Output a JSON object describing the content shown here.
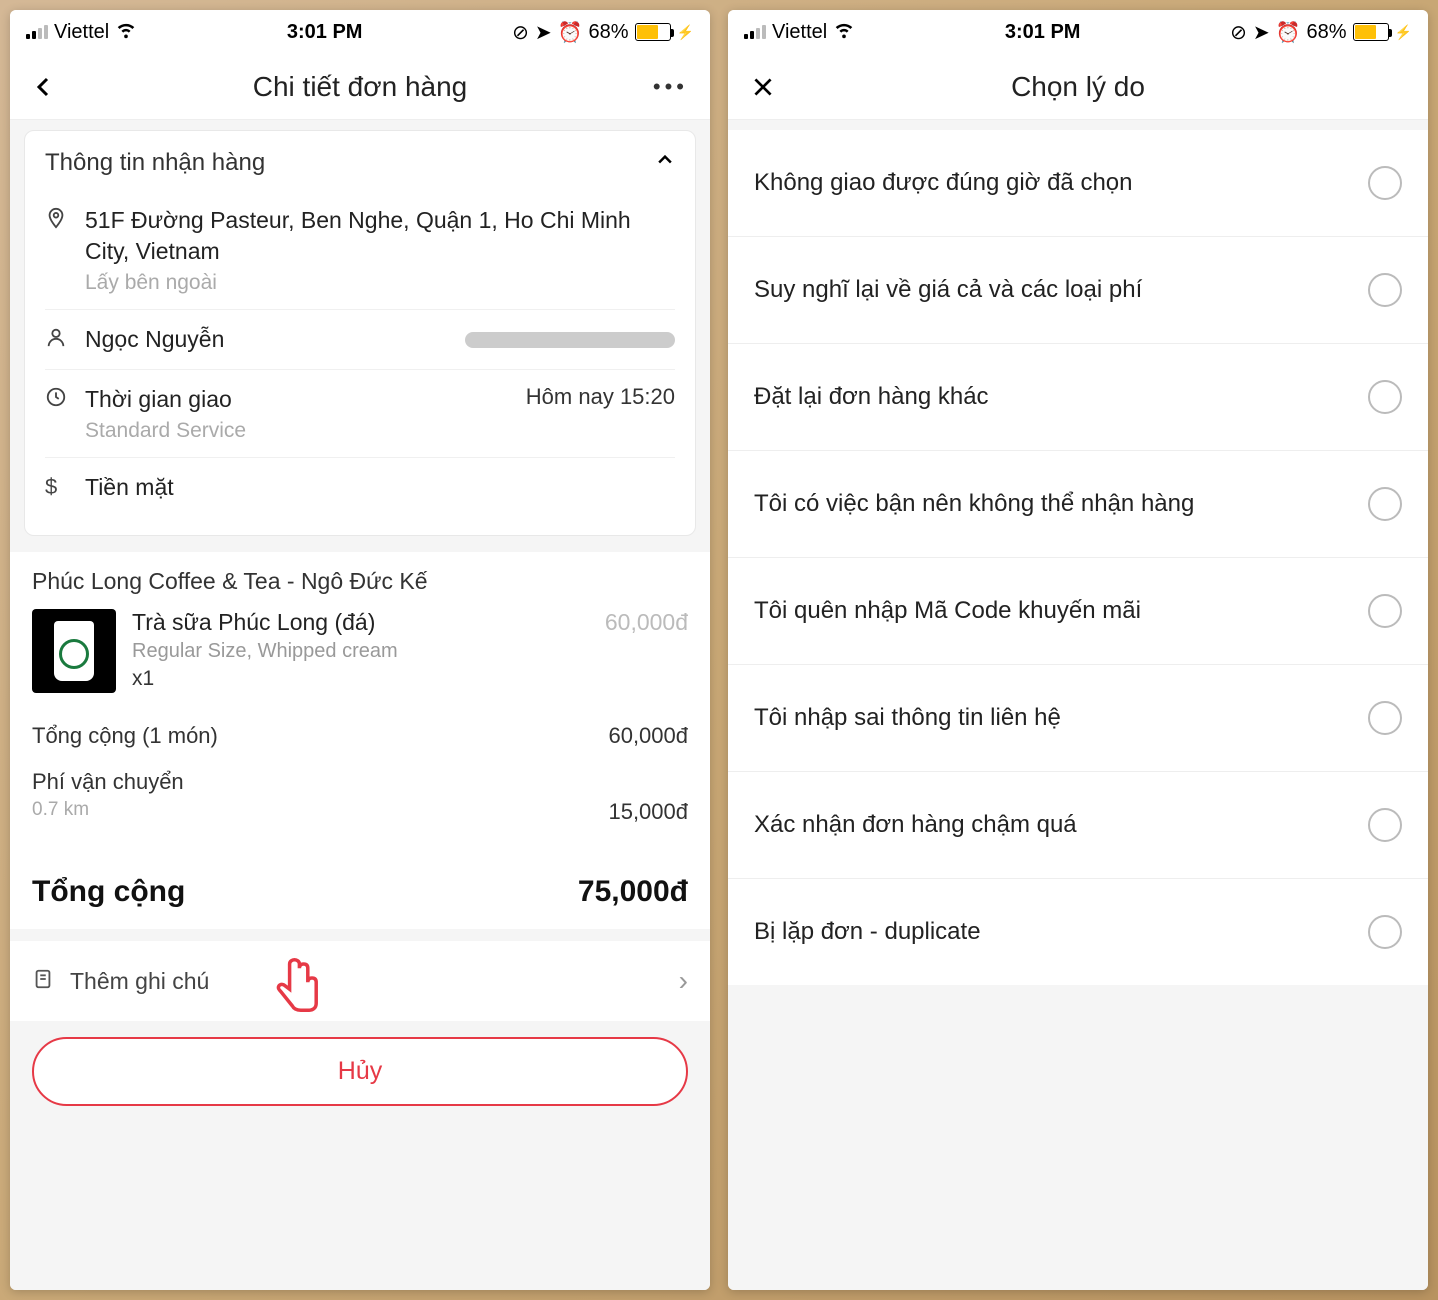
{
  "status": {
    "carrier": "Viettel",
    "time": "3:01 PM",
    "battery": "68%"
  },
  "left": {
    "title": "Chi tiết đơn hàng",
    "delivery_section_title": "Thông tin nhận hàng",
    "address": "51F Đường Pasteur, Ben Nghe, Quận 1, Ho Chi Minh City, Vietnam",
    "address_note": "Lấy bên ngoài",
    "customer_name": "Ngọc Nguyễn",
    "delivery_time_label": "Thời gian giao",
    "delivery_service": "Standard Service",
    "delivery_time_value": "Hôm nay 15:20",
    "payment_method": "Tiền mặt",
    "merchant": "Phúc Long Coffee & Tea - Ngô Đức Kế",
    "product": {
      "name": "Trà sữa Phúc Long (đá)",
      "desc": "Regular Size, Whipped cream",
      "qty": "x1",
      "price": "60,000đ"
    },
    "subtotal_label": "Tổng cộng (1 món)",
    "subtotal_value": "60,000đ",
    "shipping_label": "Phí vận chuyển",
    "shipping_distance": "0.7 km",
    "shipping_value": "15,000đ",
    "total_label": "Tổng cộng",
    "total_value": "75,000đ",
    "note_label": "Thêm ghi chú",
    "cancel_button": "Hủy"
  },
  "right": {
    "title": "Chọn lý do",
    "reasons": [
      "Không giao được đúng giờ đã chọn",
      "Suy nghĩ lại về giá cả và các loại phí",
      "Đặt lại đơn hàng khác",
      "Tôi có việc bận nên không thể nhận hàng",
      "Tôi quên nhập Mã Code khuyến mãi",
      "Tôi nhập sai thông tin liên hệ",
      "Xác nhận đơn hàng chậm quá",
      "Bị lặp đơn - duplicate"
    ]
  }
}
